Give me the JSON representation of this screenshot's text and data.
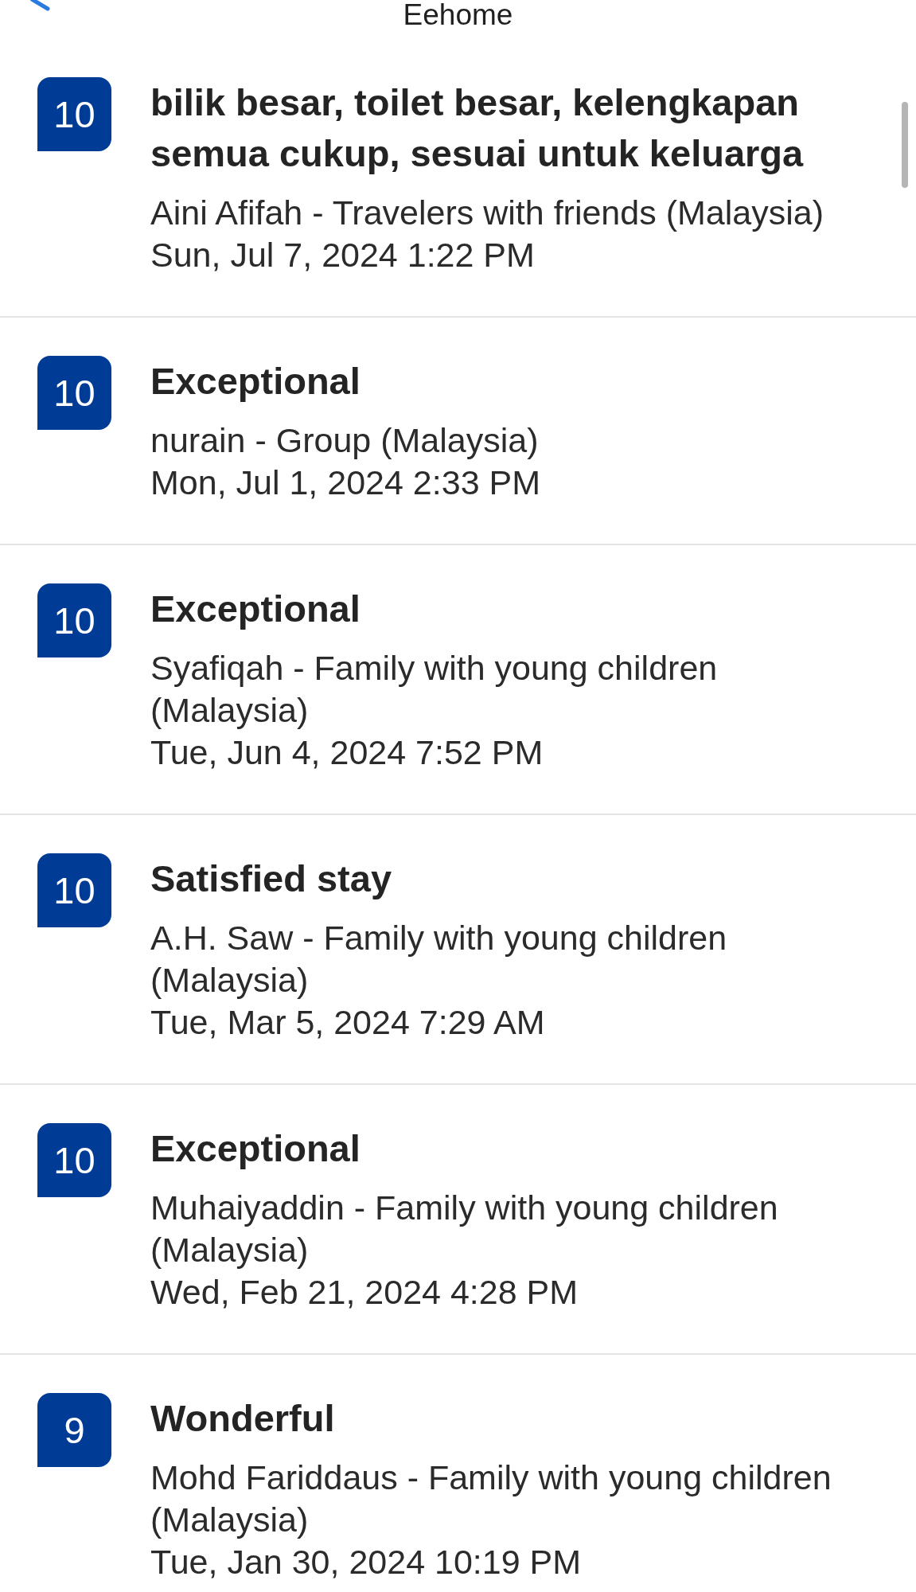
{
  "header": {
    "title": "Eehome"
  },
  "reviews": [
    {
      "score": "10",
      "title": "bilik besar, toilet besar, kelengkapan semua cukup, sesuai untuk keluarga",
      "reviewer": "Aini Afifah - Travelers with friends (Malaysia)",
      "date": "Sun, Jul 7, 2024 1:22 PM"
    },
    {
      "score": "10",
      "title": "Exceptional",
      "reviewer": "nurain - Group (Malaysia)",
      "date": "Mon, Jul 1, 2024 2:33 PM"
    },
    {
      "score": "10",
      "title": "Exceptional",
      "reviewer": "Syafiqah - Family with young children (Malaysia)",
      "date": "Tue, Jun 4, 2024 7:52 PM"
    },
    {
      "score": "10",
      "title": "Satisfied stay",
      "reviewer": "A.H. Saw - Family with young children (Malaysia)",
      "date": "Tue, Mar 5, 2024 7:29 AM"
    },
    {
      "score": "10",
      "title": "Exceptional",
      "reviewer": "Muhaiyaddin - Family with young children (Malaysia)",
      "date": "Wed, Feb 21, 2024 4:28 PM"
    },
    {
      "score": "9",
      "title": "Wonderful",
      "reviewer": "Mohd Fariddaus - Family with young children (Malaysia)",
      "date": "Tue, Jan 30, 2024 10:19 PM"
    }
  ]
}
